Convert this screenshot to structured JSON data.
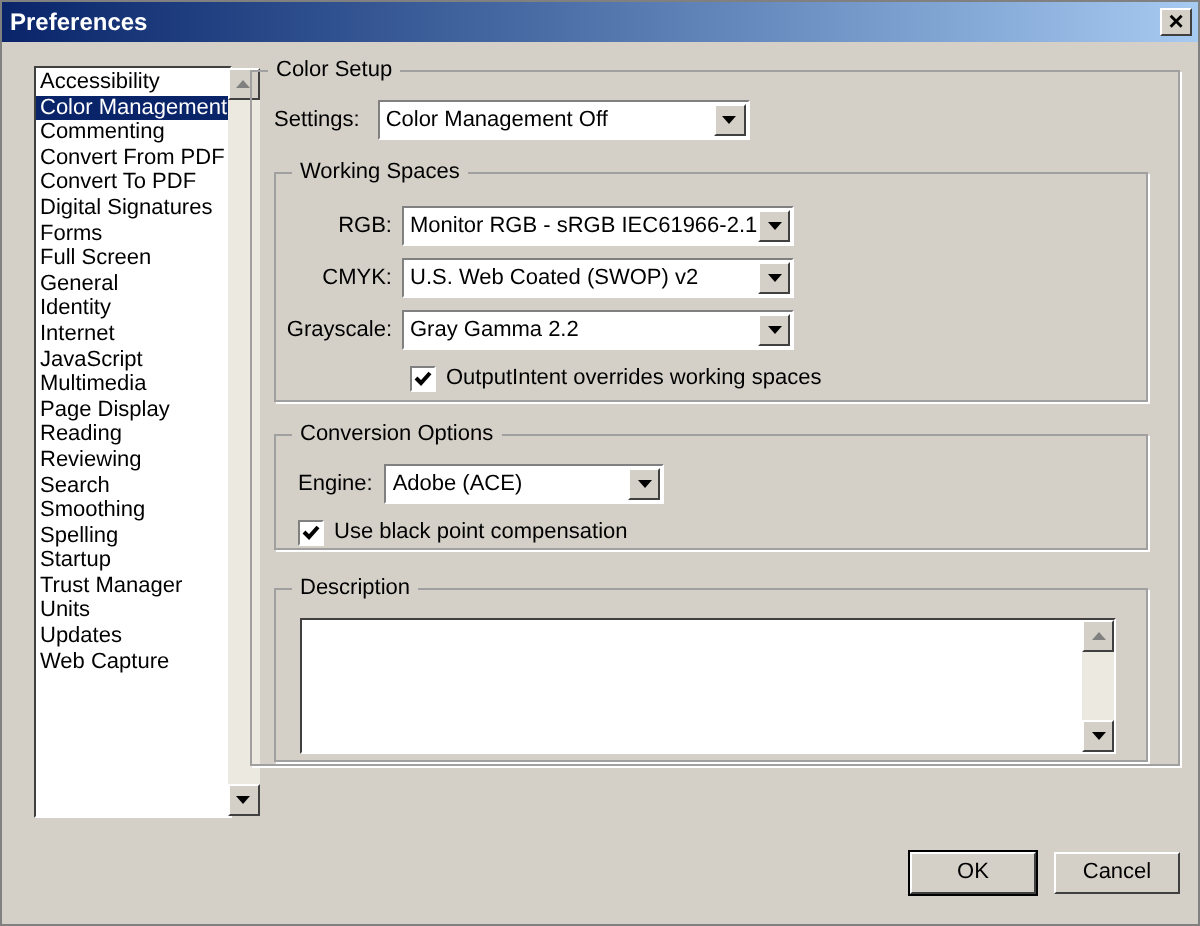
{
  "window": {
    "title": "Preferences",
    "close": "×"
  },
  "categories": [
    {
      "label": "Accessibility",
      "selected": false
    },
    {
      "label": "Color Management",
      "selected": true
    },
    {
      "label": "Commenting",
      "selected": false
    },
    {
      "label": "Convert From PDF",
      "selected": false
    },
    {
      "label": "Convert To PDF",
      "selected": false
    },
    {
      "label": "Digital Signatures",
      "selected": false
    },
    {
      "label": "Forms",
      "selected": false
    },
    {
      "label": "Full Screen",
      "selected": false
    },
    {
      "label": "General",
      "selected": false
    },
    {
      "label": "Identity",
      "selected": false
    },
    {
      "label": "Internet",
      "selected": false
    },
    {
      "label": "JavaScript",
      "selected": false
    },
    {
      "label": "Multimedia",
      "selected": false
    },
    {
      "label": "Page Display",
      "selected": false
    },
    {
      "label": "Reading",
      "selected": false
    },
    {
      "label": "Reviewing",
      "selected": false
    },
    {
      "label": "Search",
      "selected": false
    },
    {
      "label": "Smoothing",
      "selected": false
    },
    {
      "label": "Spelling",
      "selected": false
    },
    {
      "label": "Startup",
      "selected": false
    },
    {
      "label": "Trust Manager",
      "selected": false
    },
    {
      "label": "Units",
      "selected": false
    },
    {
      "label": "Updates",
      "selected": false
    },
    {
      "label": "Web Capture",
      "selected": false
    }
  ],
  "color_setup": {
    "title": "Color Setup",
    "settings": {
      "label": "Settings:",
      "value": "Color Management Off"
    },
    "working_spaces": {
      "title": "Working Spaces",
      "fields": [
        {
          "label": "RGB:",
          "value": "Monitor RGB - sRGB IEC61966-2.1"
        },
        {
          "label": "CMYK:",
          "value": "U.S. Web Coated (SWOP) v2"
        },
        {
          "label": "Grayscale:",
          "value": "Gray Gamma 2.2"
        }
      ],
      "override": {
        "label": "OutputIntent overrides working spaces",
        "checked": true
      }
    },
    "conversion": {
      "title": "Conversion Options",
      "engine": {
        "label": "Engine:",
        "value": "Adobe (ACE)"
      },
      "black_point": {
        "label": "Use black point compensation",
        "checked": true
      }
    },
    "description": {
      "title": "Description"
    }
  },
  "buttons": [
    "OK",
    "Cancel"
  ]
}
